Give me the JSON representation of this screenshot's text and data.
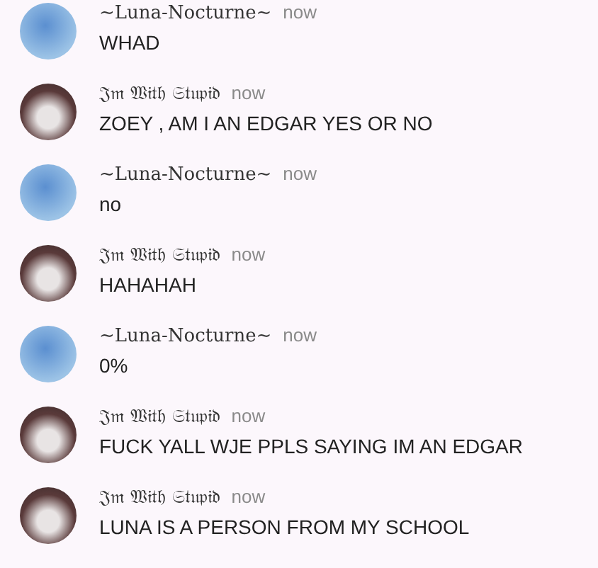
{
  "messages": [
    {
      "author": "~Luna-Nocturne~",
      "kind": "hedgehog",
      "time": "now",
      "text": "WHAD"
    },
    {
      "author": "𝔍𝔪 𝔚𝔦𝔱𝔥 𝔖𝔱𝔲𝔭𝔦𝔡",
      "kind": "car",
      "time": "now",
      "text": "ZOEY , AM I AN EDGAR YES OR NO"
    },
    {
      "author": "~Luna-Nocturne~",
      "kind": "hedgehog",
      "time": "now",
      "text": "no"
    },
    {
      "author": "𝔍𝔪 𝔚𝔦𝔱𝔥 𝔖𝔱𝔲𝔭𝔦𝔡",
      "kind": "car",
      "time": "now",
      "text": "HAHAHAH"
    },
    {
      "author": "~Luna-Nocturne~",
      "kind": "hedgehog",
      "time": "now",
      "text": "0%"
    },
    {
      "author": "𝔍𝔪 𝔚𝔦𝔱𝔥 𝔖𝔱𝔲𝔭𝔦𝔡",
      "kind": "car",
      "time": "now",
      "text": "FUCK YALL WJE PPLS SAYING IM AN EDGAR"
    },
    {
      "author": "𝔍𝔪 𝔚𝔦𝔱𝔥 𝔖𝔱𝔲𝔭𝔦𝔡",
      "kind": "car",
      "time": "now",
      "text": "LUNA IS A PERSON FROM MY SCHOOL"
    }
  ]
}
